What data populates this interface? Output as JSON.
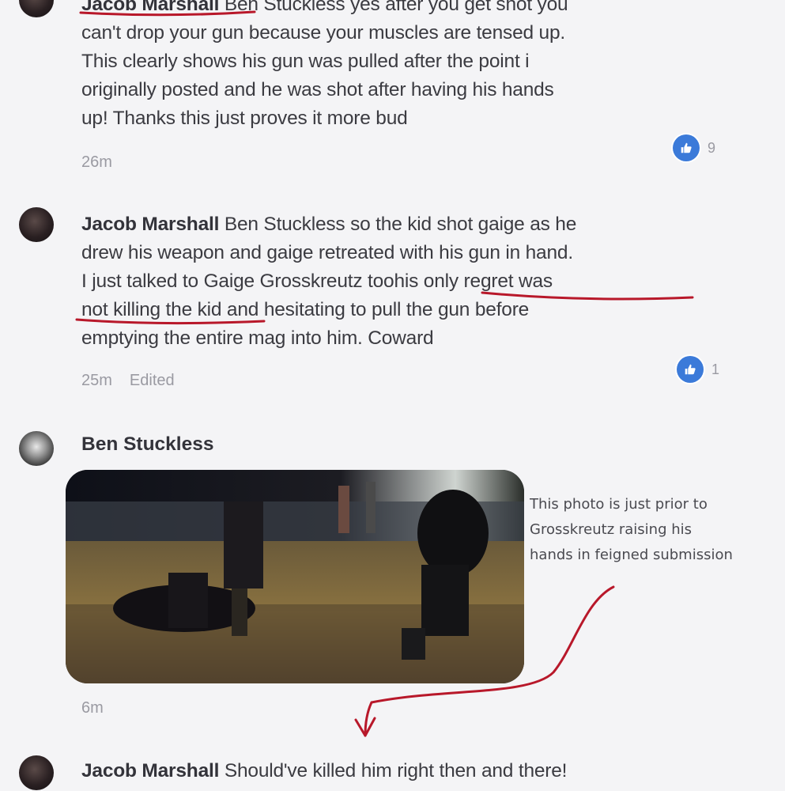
{
  "comments": [
    {
      "author": "Jacob Marshall",
      "lines": [
        " Ben Stuckless yes after you get shot you",
        "can't drop your gun because your muscles are tensed up.",
        "This clearly shows his gun was pulled after the point i",
        "originally posted and he was shot after having his hands",
        "up! Thanks this just proves it more bud"
      ],
      "time": "26m",
      "likes": "9"
    },
    {
      "author": "Jacob Marshall",
      "lines": [
        " Ben Stuckless so the kid shot gaige as he",
        "drew his weapon and gaige retreated with his gun in hand.",
        "I just talked to Gaige Grosskreutz toohis only regret was",
        "not killing the kid and hesitating to pull the gun before",
        "emptying the entire mag into him. Coward"
      ],
      "time": "25m",
      "edited": "Edited",
      "likes": "1"
    },
    {
      "author": "Ben Stuckless",
      "photo_caption": [
        "This photo is just prior to",
        "Grosskreutz raising his",
        "hands in feigned submission"
      ],
      "time": "6m"
    },
    {
      "author": "Jacob Marshall",
      "text": " Should've killed him right then and there!"
    }
  ],
  "icons": {
    "like": "thumbs-up-icon",
    "avatar": "profile-avatar"
  },
  "colors": {
    "like_blue": "#3b7ad9",
    "annotation_red": "#b8182a",
    "meta_gray": "#9a9aa2"
  }
}
